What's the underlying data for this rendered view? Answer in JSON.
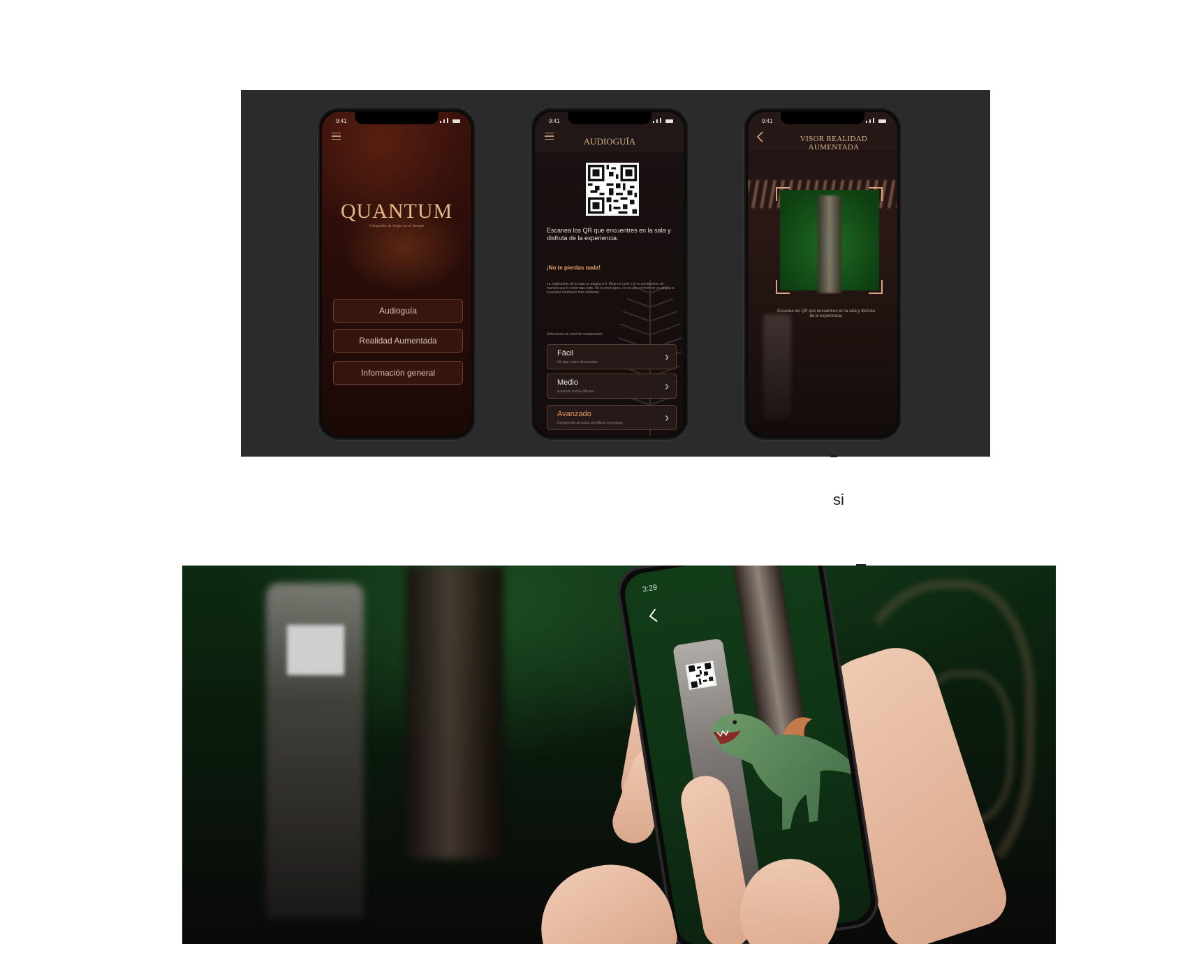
{
  "mockups": {
    "home": {
      "status_time": "9:41",
      "logo": "QUANTUM",
      "tagline": "Compañía de viajes en el tiempo",
      "buttons": [
        "Audioguía",
        "Realidad Aumentada",
        "Información general"
      ]
    },
    "audioguide": {
      "status_time": "9:41",
      "title": "AUDIOGUÍA",
      "scan_text": "Escanea los QR que encuentres en la sala y disfruta de la experiencia.",
      "heading": "¡No te pierdas nada!",
      "small_text": "La explicación de la sala se adapta a ti. Elige un nivel y te lo contaremos de manera que lo entiendas todo. No te preocupes, si ves que el nivel no se adapta a ti puedes cambiarlo más adelante.",
      "select_label": "Selecciona un nivel de comprensión",
      "levels": [
        {
          "title": "Fácil",
          "subtitle": "Sé algo sobre dinosaurios"
        },
        {
          "title": "Medio",
          "subtitle": "Entiendo textos difíciles"
        },
        {
          "title": "Avanzado",
          "subtitle": "Comprendo artículos científicos complejos"
        }
      ]
    },
    "ar_viewer": {
      "status_time": "9:41",
      "title": "VISOR REALIDAD AUMENTADA",
      "caption": "Escanea los QR que encuentres en la sala y disfruta de la experiencia."
    }
  },
  "stray_text": "si",
  "photo": {
    "phone_time": "3:29"
  }
}
